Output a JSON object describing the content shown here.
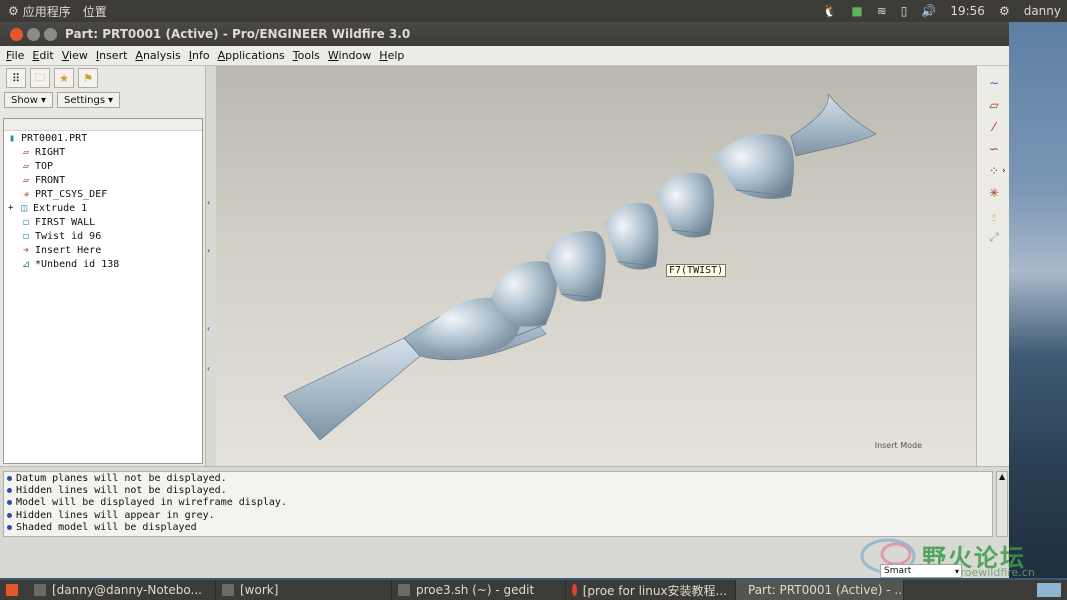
{
  "top_panel": {
    "apps": "应用程序",
    "places": "位置",
    "time": "19:56",
    "user": "danny"
  },
  "window": {
    "title": "Part: PRT0001 (Active) - Pro/ENGINEER Wildfire 3.0"
  },
  "menu": [
    "File",
    "Edit",
    "View",
    "Insert",
    "Analysis",
    "Info",
    "Applications",
    "Tools",
    "Window",
    "Help"
  ],
  "panel": {
    "show_label": "Show",
    "settings_label": "Settings"
  },
  "tree": [
    {
      "label": "PRT0001.PRT",
      "icon": "part-icon"
    },
    {
      "label": "RIGHT",
      "icon": "datum-plane-icon"
    },
    {
      "label": "TOP",
      "icon": "datum-plane-icon"
    },
    {
      "label": "FRONT",
      "icon": "datum-plane-icon"
    },
    {
      "label": "PRT_CSYS_DEF",
      "icon": "csys-icon"
    },
    {
      "label": "Extrude 1",
      "icon": "extrude-icon"
    },
    {
      "label": "FIRST WALL",
      "icon": "wall-icon"
    },
    {
      "label": "Twist id 96",
      "icon": "twist-icon"
    },
    {
      "label": "Insert Here",
      "icon": "insert-arrow-icon"
    },
    {
      "label": "*Unbend id 138",
      "icon": "unbend-icon"
    }
  ],
  "graphics": {
    "tooltip": "F7(TWIST)",
    "mode": "Insert Mode"
  },
  "messages": [
    "Datum planes will not be displayed.",
    "Hidden lines will not be displayed.",
    "Model will be displayed in wireframe display.",
    "Hidden lines will appear in grey.",
    "Shaded model will be displayed"
  ],
  "status": {
    "filter": "Smart"
  },
  "watermark": {
    "text": "野火论坛",
    "url": "www.proewildfire.cn"
  },
  "taskbar": [
    "[danny@danny-Notebo...",
    "[work]",
    "proe3.sh (~) - gedit",
    "[proe for linux安装教程...",
    "Part: PRT0001 (Active) - ..."
  ],
  "colors": {
    "panel_dark": "#3c3b37",
    "model": "#aabdcb",
    "selected_accent": "#2c2c9f"
  }
}
